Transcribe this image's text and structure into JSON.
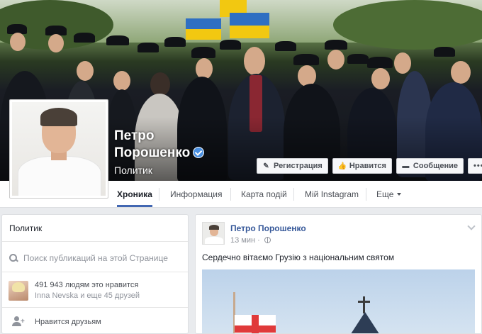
{
  "page": {
    "name_line1": "Петро",
    "name_line2": "Порошенко",
    "category": "Политик"
  },
  "actions": {
    "register": "Регистрация",
    "like": "Нравится",
    "message": "Сообщение",
    "more": "•••"
  },
  "tabs": [
    {
      "label": "Хроника"
    },
    {
      "label": "Информация"
    },
    {
      "label": "Карта подій"
    },
    {
      "label": "Мій Instagram"
    },
    {
      "label": "Еще"
    }
  ],
  "sidebar": {
    "category": "Политик",
    "search_placeholder": "Поиск публикаций на этой Странице",
    "likes_count": "491 943 людям это нравится",
    "likes_friends": "Inna Nevska и еще 45 друзей",
    "friends_like": "Нравится друзьям"
  },
  "post": {
    "author": "Петро Порошенко",
    "time": "13 мин",
    "text": "Сердечно вітаємо Грузію з національним святом"
  },
  "colors": {
    "accent": "#4267b2",
    "link": "#365899",
    "verified": "#4a90e2"
  }
}
